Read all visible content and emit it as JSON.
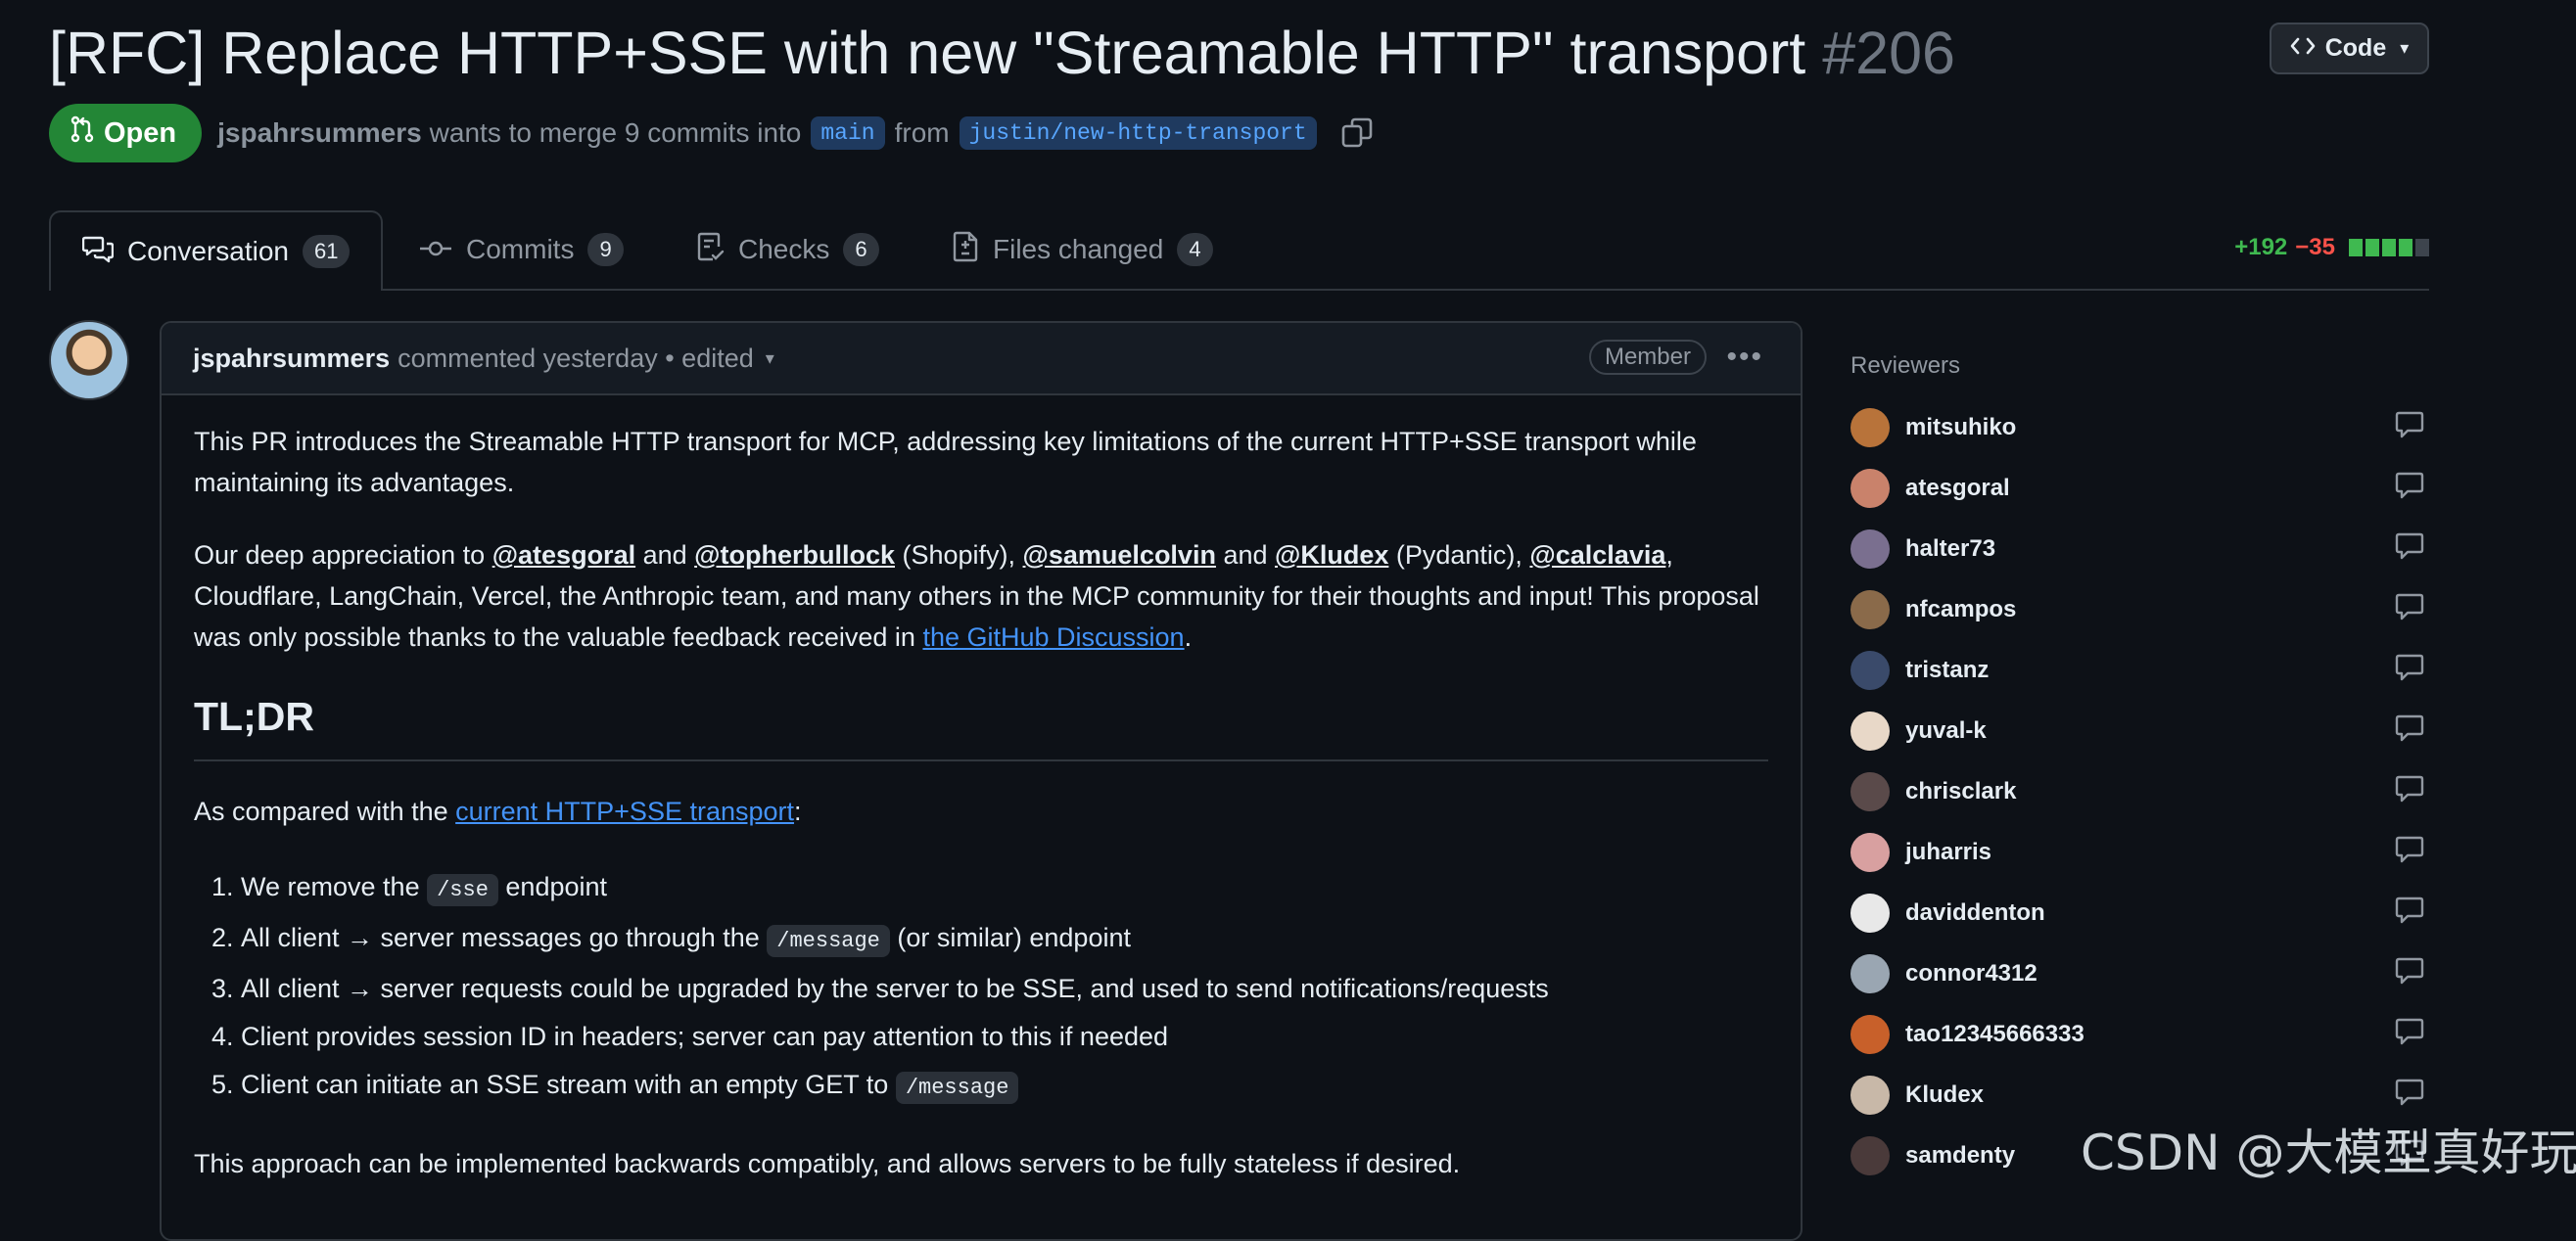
{
  "header": {
    "title": "[RFC] Replace HTTP+SSE with new \"Streamable HTTP\" transport",
    "number": "#206",
    "code_button": "Code",
    "state": "Open",
    "author": "jspahrsummers",
    "merge_text_1": "wants to merge 9 commits into",
    "base_branch": "main",
    "merge_text_2": "from",
    "head_branch": "justin/new-http-transport"
  },
  "tabs": [
    {
      "label": "Conversation",
      "count": "61"
    },
    {
      "label": "Commits",
      "count": "9"
    },
    {
      "label": "Checks",
      "count": "6"
    },
    {
      "label": "Files changed",
      "count": "4"
    }
  ],
  "diffstat": {
    "additions": "+192",
    "deletions": "−35",
    "colors": [
      "#3fb950",
      "#3fb950",
      "#3fb950",
      "#3fb950",
      "#3d444d"
    ]
  },
  "comment": {
    "author": "jspahrsummers",
    "meta": "commented yesterday • edited",
    "role": "Member",
    "p1": "This PR introduces the Streamable HTTP transport for MCP, addressing key limitations of the current HTTP+SSE transport while maintaining its advantages.",
    "p2": {
      "t1": "Our deep appreciation to ",
      "m1": "@atesgoral",
      "t2": " and ",
      "m2": "@topherbullock",
      "t3": " (Shopify), ",
      "m3": "@samuelcolvin",
      "t4": " and ",
      "m4": "@Kludex",
      "t5": " (Pydantic), ",
      "m5": "@calclavia",
      "t6": ", Cloudflare, LangChain, Vercel, the Anthropic team, and many others in the MCP community for their thoughts and input! This proposal was only possible thanks to the valuable feedback received in ",
      "link": "the GitHub Discussion",
      "t7": "."
    },
    "heading": "TL;DR",
    "p3": {
      "t1": "As compared with the ",
      "link": "current HTTP+SSE transport",
      "t2": ":"
    },
    "list": [
      {
        "a": "We remove the ",
        "code": "/sse",
        "b": " endpoint"
      },
      {
        "a": "All client → server messages go through the ",
        "code": "/message",
        "b": " (or similar) endpoint"
      },
      {
        "a": "All client → server requests could be upgraded by the server to be SSE, and used to send notifications/requests",
        "code": "",
        "b": ""
      },
      {
        "a": "Client provides session ID in headers; server can pay attention to this if needed",
        "code": "",
        "b": ""
      },
      {
        "a": "Client can initiate an SSE stream with an empty GET to ",
        "code": "/message",
        "b": ""
      }
    ],
    "p4": "This approach can be implemented backwards compatibly, and allows servers to be fully stateless if desired."
  },
  "sidebar": {
    "title": "Reviewers",
    "reviewers": [
      {
        "name": "mitsuhiko",
        "color": "#b8733a"
      },
      {
        "name": "atesgoral",
        "color": "#c9826b"
      },
      {
        "name": "halter73",
        "color": "#7a6f8f"
      },
      {
        "name": "nfcampos",
        "color": "#8a6a4a"
      },
      {
        "name": "tristanz",
        "color": "#3a4a6a"
      },
      {
        "name": "yuval-k",
        "color": "#e8d8c8"
      },
      {
        "name": "chrisclark",
        "color": "#5a4a4a"
      },
      {
        "name": "juharris",
        "color": "#d8a0a0"
      },
      {
        "name": "daviddenton",
        "color": "#e8e8e8"
      },
      {
        "name": "connor4312",
        "color": "#9aa6b2"
      },
      {
        "name": "tao12345666333",
        "color": "#c8602a"
      },
      {
        "name": "Kludex",
        "color": "#c8b8a8"
      },
      {
        "name": "samdenty",
        "color": "#4a3a3a"
      }
    ]
  },
  "watermark": "CSDN @大模型真好玩"
}
